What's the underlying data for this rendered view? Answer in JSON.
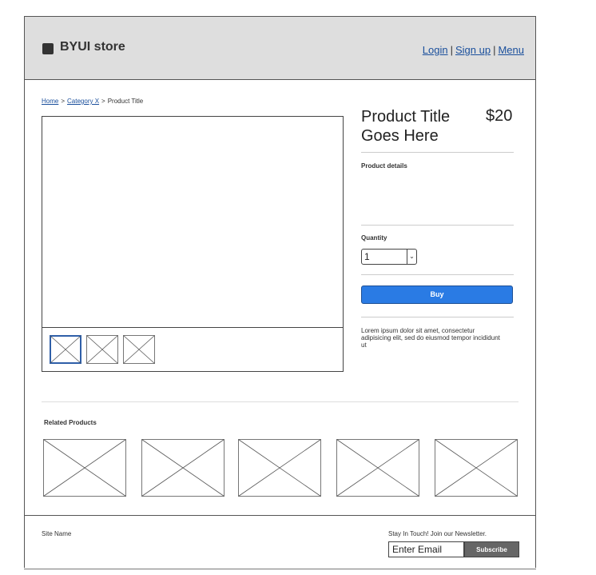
{
  "header": {
    "brand": "BYUI store",
    "nav": {
      "login": "Login",
      "signup": "Sign up",
      "menu": "Menu",
      "separator": "|"
    }
  },
  "breadcrumb": {
    "home": "Home",
    "category": "Category X",
    "current": "Product Title",
    "separator": ">"
  },
  "product": {
    "title": "Product Title Goes Here",
    "price": "$20",
    "details_label": "Product details",
    "quantity_label": "Quantity",
    "quantity_value": "1",
    "buy_label": "Buy",
    "description": "Lorem ipsum dolor sit amet, consectetur adipisicing elit, sed do eiusmod tempor incididunt ut"
  },
  "related": {
    "label": "Related Products"
  },
  "footer": {
    "site_name": "Site Name",
    "newsletter_text": "Stay In Touch! Join our Newsletter.",
    "email_placeholder": "Enter Email",
    "subscribe_label": "Subscribe"
  },
  "colors": {
    "header_bg": "#dedede",
    "link": "#1a4f9c",
    "buy_button": "#2a7be4",
    "subscribe_button": "#666666"
  },
  "icons": {
    "logo": "square-logo-icon",
    "select_arrow": "chevron-down-icon",
    "placeholder": "image-placeholder-icon"
  }
}
